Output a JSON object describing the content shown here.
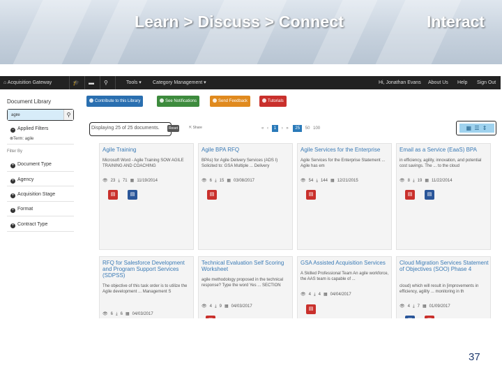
{
  "banner": {
    "title": "Learn > Discuss > Connect",
    "interact": "Interact"
  },
  "nav": {
    "brand": "Acquisition Gateway",
    "tools": "Tools ▾",
    "category": "Category Management ▾",
    "user": "Hi, Jonathan Evans",
    "about": "About Us",
    "help": "Help",
    "signout": "Sign Out"
  },
  "sidebar": {
    "title": "Document Library",
    "search_value": "agile",
    "applied_filters": "Applied Filters",
    "term": "Term: agile",
    "filter_by": "Filter By",
    "filters": [
      "Document Type",
      "Agency",
      "Acquisition Stage",
      "Format",
      "Contract Type"
    ]
  },
  "actions": {
    "contribute": "Contribute to this Library",
    "notifications": "See Notifications",
    "feedback": "Send Feedback",
    "tutorials": "Tutorials"
  },
  "results": {
    "displaying": "Displaying 25 of 25 documents.",
    "reset": "Reset",
    "share": "Share",
    "pager_prev": "«",
    "pager_prev2": "‹",
    "pager_current": "1",
    "pager_next": "›",
    "pager_next2": "»",
    "size_active": "25",
    "size_50": "50",
    "size_100": "100",
    "view_icons": "▦ ☰ ⇕"
  },
  "cards": [
    {
      "title": "Agile Training",
      "desc": "Microsoft Word - Agile Training SOW AGILE TRAINING AND COACHING",
      "views": "23",
      "downloads": "71",
      "date": "11/19/2014",
      "buttons": [
        "pdf",
        "word"
      ]
    },
    {
      "title": "Agile BPA RFQ",
      "desc": "BPAs) for Agile Delivery Services (ADS I) Solicited to: GSA Multiple ... Delivery",
      "views": "6",
      "downloads": "15",
      "date": "03/08/2017",
      "buttons": [
        "pdf"
      ]
    },
    {
      "title": "Agile Services for the Enterprise",
      "desc": "Agile Services for the Enterprise Statement ... Agile has em",
      "views": "54",
      "downloads": "144",
      "date": "12/21/2015",
      "buttons": [
        "pdf"
      ]
    },
    {
      "title": "Email as a Service (EaaS) BPA",
      "desc": "in efficiency, agility, innovation, and potential cost savings. The ... to the cloud",
      "views": "8",
      "downloads": "19",
      "date": "11/22/2014",
      "buttons": [
        "pdf",
        "word"
      ]
    },
    {
      "title": "RFQ for Salesforce Development and Program Support Services (SDPSS)",
      "desc": "The objective of this task order is to utilize the Agile development ... Management S",
      "views": "6",
      "downloads": "6",
      "date": "04/03/2017",
      "buttons": [
        "pdf"
      ]
    },
    {
      "title": "Technical Evaluation Self Scoring Worksheet",
      "desc": "agile methodology proposed in the technical response? Type the word Yes ... SECTION",
      "views": "4",
      "downloads": "9",
      "date": "04/03/2017",
      "buttons": [
        "pdf"
      ]
    },
    {
      "title": "GSA Assisted Acquisition Services",
      "desc": "A Skilled Professional Team An agile workforce, the AAS team is capable of ...",
      "views": "4",
      "downloads": "4",
      "date": "04/04/2017",
      "buttons": [
        "pdf"
      ]
    },
    {
      "title": "Cloud Migration Services Statement of Objectives (SOO) Phase 4",
      "desc": "cloud) which will result in [improvements in efficiency, agility ... monitoring in th",
      "views": "4",
      "downloads": "7",
      "date": "01/09/2017",
      "buttons": [
        "word",
        "pdf"
      ]
    }
  ],
  "page_number": "37"
}
